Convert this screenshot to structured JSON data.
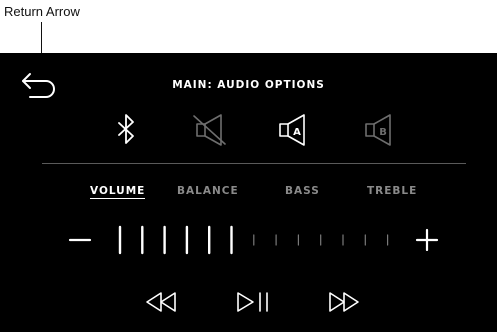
{
  "annotation": {
    "label": "Return Arrow"
  },
  "screen": {
    "title": "MAIN: AUDIO OPTIONS",
    "background": "#000000",
    "foreground": "#ffffff",
    "inactive_color": "#8a8a8a"
  },
  "sources": [
    {
      "icon": "bluetooth-icon",
      "state": "active"
    },
    {
      "icon": "speaker-muted-icon",
      "state": "dimmed"
    },
    {
      "icon": "speaker-a-icon",
      "label": "A",
      "state": "active"
    },
    {
      "icon": "speaker-b-icon",
      "label": "B",
      "state": "dimmed"
    }
  ],
  "tabs": [
    {
      "label": "VOLUME",
      "active": true
    },
    {
      "label": "BALANCE",
      "active": false
    },
    {
      "label": "BASS",
      "active": false
    },
    {
      "label": "TREBLE",
      "active": false
    }
  ],
  "level": {
    "value": 6,
    "max": 13,
    "decrease_symbol": "−",
    "increase_symbol": "+"
  },
  "transport": [
    {
      "icon": "rewind-icon"
    },
    {
      "icon": "play-pause-icon"
    },
    {
      "icon": "fast-forward-icon"
    }
  ]
}
